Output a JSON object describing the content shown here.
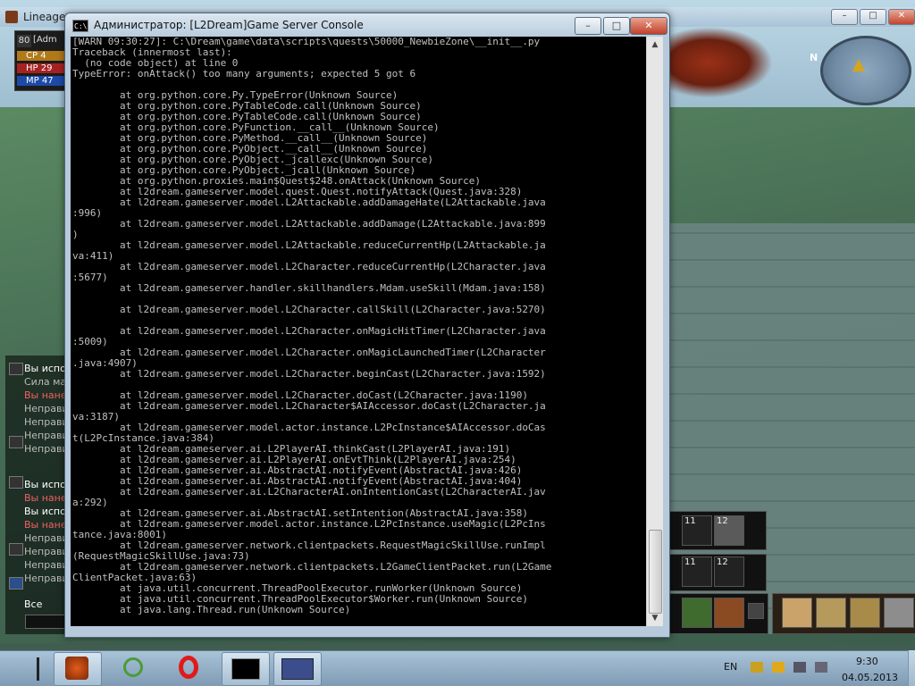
{
  "game_window": {
    "title": "Lineage"
  },
  "status": {
    "level": "80",
    "name": "[Adm",
    "cp": "CP 4",
    "hp": "HP 29",
    "mp": "MP 47"
  },
  "chat": {
    "lines1": [
      "Вы испол",
      "Сила маг",
      "Вы нанес",
      "Неправи",
      "Неправи",
      "Неправи",
      "Неправи"
    ],
    "lines2": [
      "Вы испол",
      "Вы нане",
      "Вы испол",
      "Вы нане",
      "Неправи",
      "Неправи",
      "Неправи",
      "Неправи"
    ],
    "input_label": "Все"
  },
  "minimap": {
    "north_label": "N"
  },
  "hotbar": {
    "slot11a": "11",
    "slot12a": "12",
    "slot11b": "11",
    "slot12b": "12"
  },
  "console": {
    "title": "Администратор:  [L2Dream]Game Server Console",
    "icon_text": "C:\\",
    "lines": [
      "[WARN 09:30:27]: C:\\Dream\\game\\data\\scripts\\quests\\50000_NewbieZone\\__init__.py",
      "Traceback (innermost last):",
      "  (no code object) at line 0",
      "TypeError: onAttack() too many arguments; expected 5 got 6",
      "",
      "        at org.python.core.Py.TypeError(Unknown Source)",
      "        at org.python.core.PyTableCode.call(Unknown Source)",
      "        at org.python.core.PyTableCode.call(Unknown Source)",
      "        at org.python.core.PyFunction.__call__(Unknown Source)",
      "        at org.python.core.PyMethod.__call__(Unknown Source)",
      "        at org.python.core.PyObject.__call__(Unknown Source)",
      "        at org.python.core.PyObject._jcallexc(Unknown Source)",
      "        at org.python.core.PyObject._jcall(Unknown Source)",
      "        at org.python.proxies.main$Quest$248.onAttack(Unknown Source)",
      "        at l2dream.gameserver.model.quest.Quest.notifyAttack(Quest.java:328)",
      "        at l2dream.gameserver.model.L2Attackable.addDamageHate(L2Attackable.java",
      ":996)",
      "        at l2dream.gameserver.model.L2Attackable.addDamage(L2Attackable.java:899",
      ")",
      "        at l2dream.gameserver.model.L2Attackable.reduceCurrentHp(L2Attackable.ja",
      "va:411)",
      "        at l2dream.gameserver.model.L2Character.reduceCurrentHp(L2Character.java",
      ":5677)",
      "        at l2dream.gameserver.handler.skillhandlers.Mdam.useSkill(Mdam.java:158)",
      "",
      "        at l2dream.gameserver.model.L2Character.callSkill(L2Character.java:5270)",
      "",
      "        at l2dream.gameserver.model.L2Character.onMagicHitTimer(L2Character.java",
      ":5009)",
      "        at l2dream.gameserver.model.L2Character.onMagicLaunchedTimer(L2Character",
      ".java:4907)",
      "        at l2dream.gameserver.model.L2Character.beginCast(L2Character.java:1592)",
      "",
      "        at l2dream.gameserver.model.L2Character.doCast(L2Character.java:1190)",
      "        at l2dream.gameserver.model.L2Character$AIAccessor.doCast(L2Character.ja",
      "va:3187)",
      "        at l2dream.gameserver.model.actor.instance.L2PcInstance$AIAccessor.doCas",
      "t(L2PcInstance.java:384)",
      "        at l2dream.gameserver.ai.L2PlayerAI.thinkCast(L2PlayerAI.java:191)",
      "        at l2dream.gameserver.ai.L2PlayerAI.onEvtThink(L2PlayerAI.java:254)",
      "        at l2dream.gameserver.ai.AbstractAI.notifyEvent(AbstractAI.java:426)",
      "        at l2dream.gameserver.ai.AbstractAI.notifyEvent(AbstractAI.java:404)",
      "        at l2dream.gameserver.ai.L2CharacterAI.onIntentionCast(L2CharacterAI.jav",
      "a:292)",
      "        at l2dream.gameserver.ai.AbstractAI.setIntention(AbstractAI.java:358)",
      "        at l2dream.gameserver.model.actor.instance.L2PcInstance.useMagic(L2PcIns",
      "tance.java:8001)",
      "        at l2dream.gameserver.network.clientpackets.RequestMagicSkillUse.runImpl",
      "(RequestMagicSkillUse.java:73)",
      "        at l2dream.gameserver.network.clientpackets.L2GameClientPacket.run(L2Game",
      "ClientPacket.java:63)",
      "        at java.util.concurrent.ThreadPoolExecutor.runWorker(Unknown Source)",
      "        at java.util.concurrent.ThreadPoolExecutor$Worker.run(Unknown Source)",
      "        at java.lang.Thread.run(Unknown Source)"
    ]
  },
  "taskbar": {
    "lang": "EN",
    "time": "9:30",
    "date": "04.05.2013",
    "apps": [
      "game-launcher",
      "media-player",
      "opera-browser",
      "command-prompt",
      "lineage-ii"
    ]
  }
}
